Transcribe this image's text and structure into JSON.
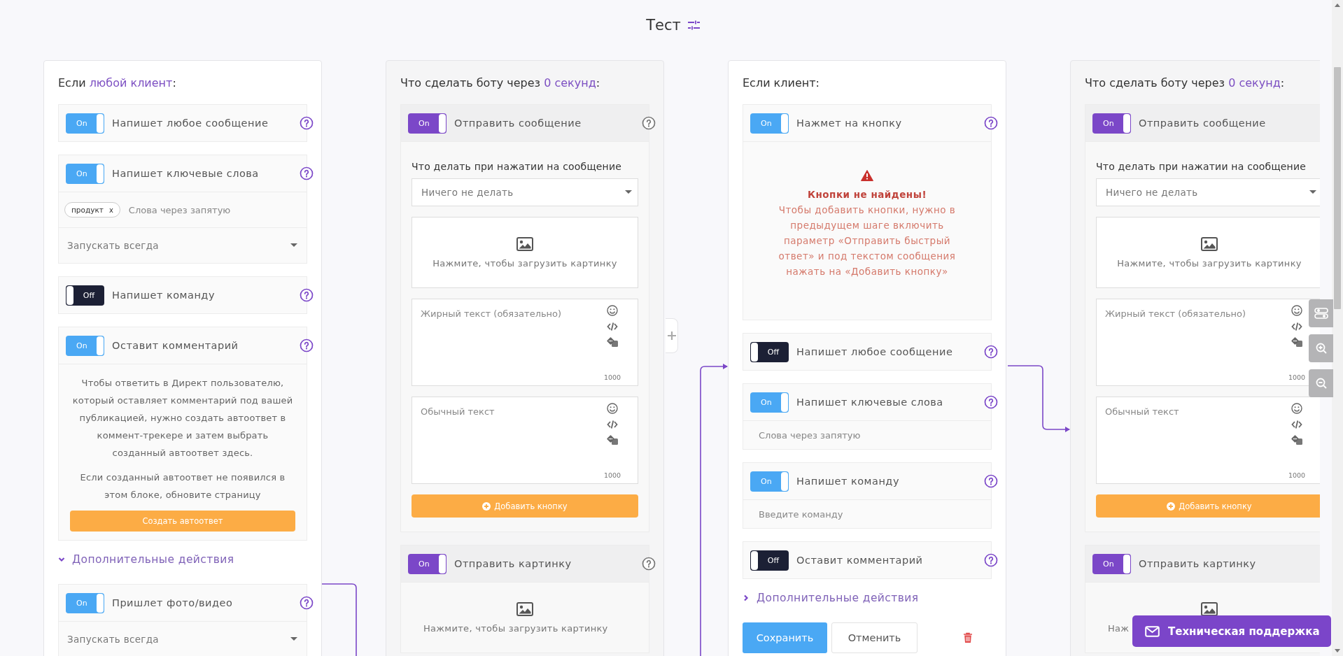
{
  "title": "Тест",
  "columns": [
    {
      "kind": "condition",
      "heading": "Если ",
      "heading_accent": "любой клиент",
      "heading_end": ":",
      "items": [
        {
          "kind": "block",
          "on": true,
          "toggle_text": "On",
          "label": "Напишет любое сообщение",
          "help": true
        },
        {
          "kind": "block",
          "on": true,
          "toggle_text": "On",
          "label": "Напишет ключевые слова",
          "help": true,
          "sections": [
            {
              "kind": "tags",
              "tags": [
                {
                  "text": "продукт",
                  "remove": "x"
                }
              ],
              "placeholder": "Слова через запятую"
            },
            {
              "kind": "select",
              "value": "Запускать всегда"
            }
          ]
        },
        {
          "kind": "block",
          "on": false,
          "toggle_text": "Off",
          "label": "Напишет команду",
          "help": true
        },
        {
          "kind": "block",
          "on": true,
          "toggle_text": "On",
          "label": "Оставит комментарий",
          "help": true,
          "sections": [
            {
              "kind": "note",
              "paragraphs": [
                "Чтобы ответить в Директ пользователю, который оставляет комментарий под вашей публикацией, нужно создать автоответ в коммент-трекере и затем выбрать созданный автоответ здесь.",
                "Если созданный автоответ не появился в этом блоке, обновите страницу"
              ],
              "button": "Создать автоответ"
            }
          ]
        },
        {
          "kind": "more",
          "label": "Дополнительные действия",
          "expanded": true
        },
        {
          "kind": "block",
          "on": true,
          "toggle_text": "On",
          "label": "Пришлет фото/видео",
          "help": true,
          "sections": [
            {
              "kind": "select",
              "value": "Запускать всегда"
            }
          ]
        }
      ]
    },
    {
      "kind": "action",
      "heading": "Что сделать боту через ",
      "heading_accent": "0 секунд",
      "heading_end": ":",
      "items": [
        {
          "kind": "block",
          "on": true,
          "toggle_text": "On",
          "label": "Отправить сообщение",
          "help": true,
          "sections": [
            {
              "kind": "form",
              "fields": [
                {
                  "kind": "label",
                  "text": "Что делать при нажатии на сообщение"
                },
                {
                  "kind": "select",
                  "value": "Ничего не делать"
                },
                {
                  "kind": "upload",
                  "text": "Нажмите, чтобы загрузить картинку"
                },
                {
                  "kind": "editor",
                  "placeholder": "Жирный текст (обязательно)",
                  "counter": "1000"
                },
                {
                  "kind": "editor",
                  "placeholder": "Обычный текст",
                  "counter": "1000"
                },
                {
                  "kind": "add_button",
                  "text": "Добавить кнопку"
                }
              ]
            }
          ]
        },
        {
          "kind": "block",
          "on": true,
          "toggle_text": "On",
          "label": "Отправить картинку",
          "help": true,
          "sections": [
            {
              "kind": "upload",
              "text": "Нажмите, чтобы загрузить картинку"
            }
          ]
        }
      ]
    },
    {
      "kind": "condition",
      "heading": "Если клиент:",
      "items": [
        {
          "kind": "block",
          "on": true,
          "toggle_text": "On",
          "label": "Нажмет на кнопку",
          "help": true,
          "sections": [
            {
              "kind": "warning",
              "title": "Кнопки не найдены!",
              "text": "Чтобы добавить кнопки, нужно в предыдущем шаге включить параметр «Отправить быстрый ответ» и под текстом сообщения нажать на «Добавить кнопку»"
            }
          ]
        },
        {
          "kind": "block",
          "on": false,
          "toggle_text": "Off",
          "label": "Напишет любое сообщение",
          "help": true
        },
        {
          "kind": "block",
          "on": true,
          "toggle_text": "On",
          "label": "Напишет ключевые слова",
          "help": true,
          "sections": [
            {
              "kind": "input",
              "placeholder": "Слова через запятую"
            }
          ]
        },
        {
          "kind": "block",
          "on": true,
          "toggle_text": "On",
          "label": "Напишет команду",
          "help": true,
          "sections": [
            {
              "kind": "input",
              "placeholder": "Введите команду"
            }
          ]
        },
        {
          "kind": "block",
          "on": false,
          "toggle_text": "Off",
          "label": "Оставит комментарий",
          "help": true
        },
        {
          "kind": "more",
          "label": "Дополнительные действия",
          "expanded": false
        },
        {
          "kind": "actions",
          "save": "Сохранить",
          "cancel": "Отменить"
        }
      ]
    },
    {
      "kind": "action",
      "heading": "Что сделать боту через ",
      "heading_accent": "0 секунд",
      "heading_end": ":",
      "items": [
        {
          "kind": "block",
          "on": true,
          "toggle_text": "On",
          "label": "Отправить сообщение",
          "help": false,
          "sections": [
            {
              "kind": "form",
              "fields": [
                {
                  "kind": "label",
                  "text": "Что делать при нажатии на сообщение"
                },
                {
                  "kind": "select",
                  "value": "Ничего не делать"
                },
                {
                  "kind": "upload",
                  "text": "Нажмите, чтобы загрузить картинку"
                },
                {
                  "kind": "editor",
                  "placeholder": "Жирный текст (обязательно)",
                  "counter": "1000"
                },
                {
                  "kind": "editor",
                  "placeholder": "Обычный текст",
                  "counter": "1000"
                },
                {
                  "kind": "add_button",
                  "text": "Добавить кнопку"
                }
              ]
            }
          ]
        },
        {
          "kind": "block",
          "on": true,
          "toggle_text": "On",
          "label": "Отправить картинку",
          "help": false,
          "sections": [
            {
              "kind": "upload",
              "text": "Наж"
            }
          ]
        }
      ]
    }
  ],
  "support": "Техническая поддержка"
}
